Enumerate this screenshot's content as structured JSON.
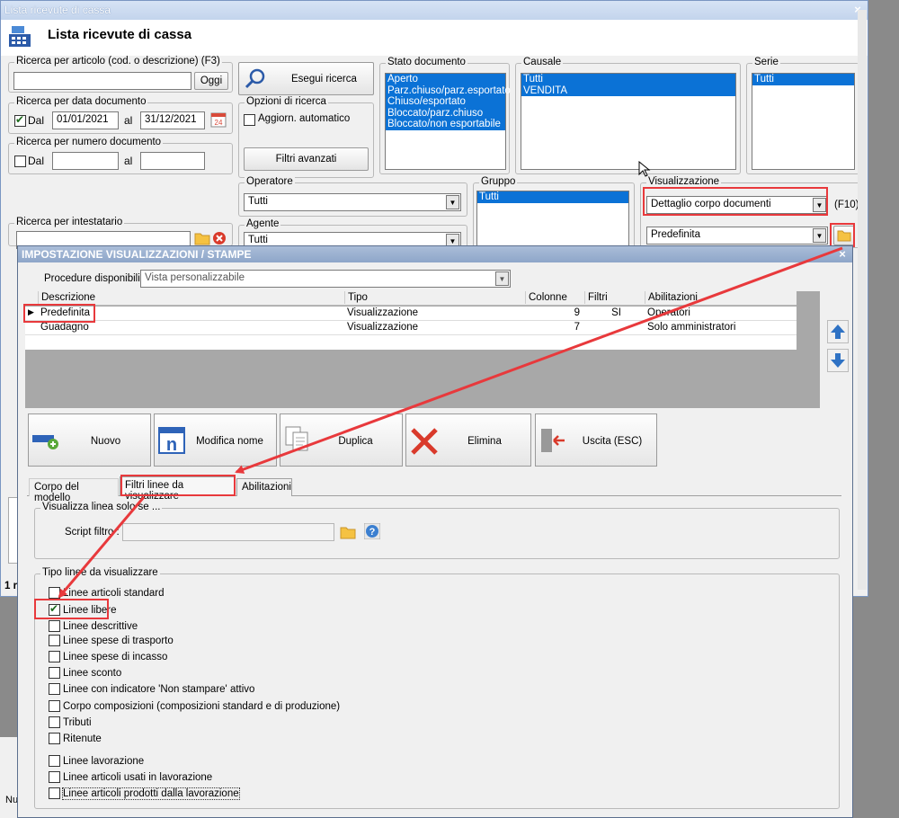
{
  "main_window": {
    "title": "Lista ricevute di cassa",
    "header_title": "Lista ricevute di cassa",
    "close": "×",
    "search_article": {
      "legend": "Ricerca per articolo (cod. o descrizione) (F3)",
      "value": "",
      "button": "Oggi"
    },
    "search_date": {
      "legend": "Ricerca per data documento",
      "checkbox_label": "Dal",
      "from": "01/01/2021",
      "to_label": "al",
      "to": "31/12/2021"
    },
    "search_number": {
      "legend": "Ricerca per numero documento",
      "checkbox_label": "Dal",
      "from": "",
      "to_label": "al",
      "to": ""
    },
    "search_holder": {
      "legend": "Ricerca per intestatario",
      "value": ""
    },
    "run_search_button": "Esegui ricerca",
    "search_options": {
      "legend": "Opzioni di ricerca",
      "auto_update_label": "Aggiorn. automatico",
      "advanced_filters_button": "Filtri avanzati"
    },
    "doc_status": {
      "legend": "Stato documento",
      "items": [
        "Aperto",
        "Parz.chiuso/parz.esportato",
        "Chiuso/esportato",
        "Bloccato/parz.chiuso",
        "Bloccato/non esportabile"
      ]
    },
    "causale": {
      "legend": "Causale",
      "items": [
        "Tutti",
        "VENDITA"
      ]
    },
    "serie": {
      "legend": "Serie",
      "items": [
        "Tutti"
      ]
    },
    "operatore": {
      "legend": "Operatore",
      "value": "Tutti"
    },
    "agente": {
      "legend": "Agente",
      "value": "Tutti"
    },
    "gruppo": {
      "legend": "Gruppo",
      "items": [
        "Tutti"
      ]
    },
    "visualizzazione": {
      "legend": "Visualizzazione",
      "value": "Dettaglio corpo documenti",
      "shortcut": "(F10)",
      "preset": "Predefinita"
    },
    "bottom_left": "1 r",
    "footer_label": "Nu"
  },
  "dialog": {
    "title": "IMPOSTAZIONE VISUALIZZAZIONI / STAMPE",
    "close": "×",
    "procedures_label": "Procedure disponibili :",
    "procedures_value": "Vista personalizzabile",
    "grid": {
      "columns": [
        "Descrizione",
        "Tipo",
        "Colonne",
        "Filtri",
        "Abilitazioni"
      ],
      "rows": [
        {
          "descrizione": "Predefinita",
          "tipo": "Visualizzazione",
          "colonne": "9",
          "filtri": "SI",
          "abilitazioni": "Operatori"
        },
        {
          "descrizione": "Guadagno",
          "tipo": "Visualizzazione",
          "colonne": "7",
          "filtri": "",
          "abilitazioni": "Solo amministratori"
        }
      ]
    },
    "buttons": {
      "new": "Nuovo",
      "rename": "Modifica nome",
      "duplicate": "Duplica",
      "delete": "Elimina",
      "exit": "Uscita (ESC)"
    },
    "tabs": [
      "Corpo del modello",
      "Filtri linee da visualizzare",
      "Abilitazioni"
    ],
    "show_line_if": {
      "legend": "Visualizza linea solo se ...",
      "script_label": "Script filtro :",
      "script_value": ""
    },
    "line_types": {
      "legend": "Tipo linee da visualizzare",
      "items": [
        {
          "label": "Linee articoli standard",
          "checked": false
        },
        {
          "label": "Linee libere",
          "checked": true
        },
        {
          "label": "Linee descrittive",
          "checked": false
        },
        {
          "label": "Linee spese di trasporto",
          "checked": false
        },
        {
          "label": "Linee spese di incasso",
          "checked": false
        },
        {
          "label": "Linee sconto",
          "checked": false
        },
        {
          "label": "Linee con indicatore 'Non stampare' attivo",
          "checked": false
        },
        {
          "label": "Corpo composizioni (composizioni standard e di produzione)",
          "checked": false
        },
        {
          "label": "Tributi",
          "checked": false
        },
        {
          "label": "Ritenute",
          "checked": false
        },
        {
          "label": "Linee lavorazione",
          "checked": false
        },
        {
          "label": "Linee articoli usati in lavorazione",
          "checked": false
        },
        {
          "label": "Linee articoli prodotti dalla lavorazione",
          "checked": false
        }
      ]
    }
  },
  "colors": {
    "selection": "#0b72d6",
    "annotation": "#e8393c",
    "title_bar": "#c3d4ec"
  }
}
